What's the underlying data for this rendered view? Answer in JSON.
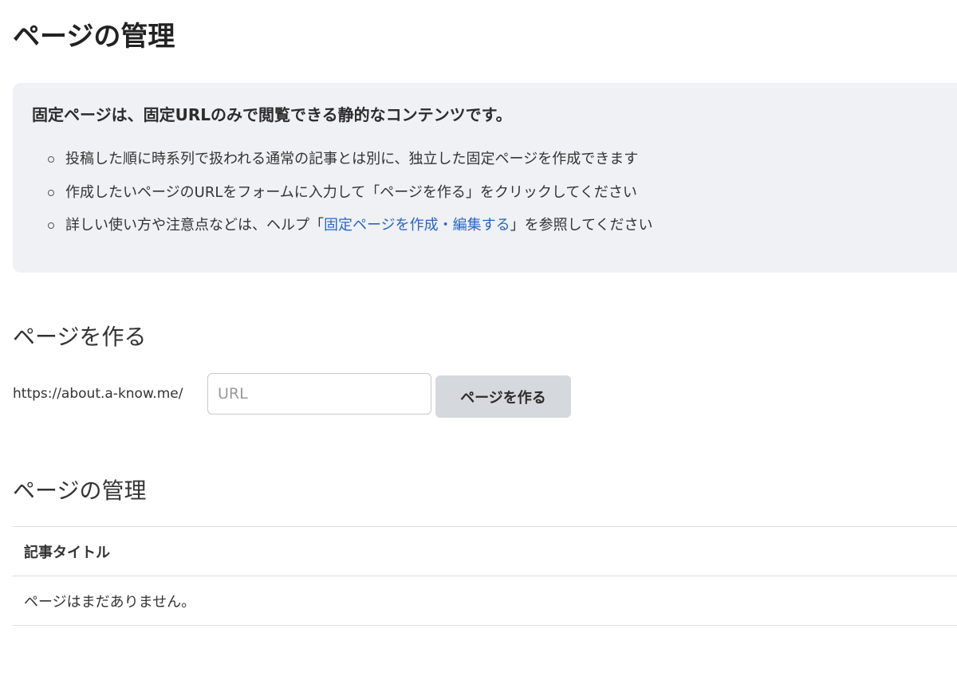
{
  "page": {
    "title": "ページの管理"
  },
  "info": {
    "lead": "固定ページは、固定URLのみで閲覧できる静的なコンテンツです。",
    "items": [
      "投稿した順に時系列で扱われる通常の記事とは別に、独立した固定ページを作成できます",
      "作成したいページのURLをフォームに入力して「ページを作る」をクリックしてください"
    ],
    "help_item": {
      "before": "詳しい使い方や注意点などは、ヘルプ「",
      "link": "固定ページを作成・編集する",
      "after": "」を参照してください"
    }
  },
  "create": {
    "heading": "ページを作る",
    "url_prefix": "https://about.a-know.me/",
    "input_value": "",
    "input_placeholder": "URL",
    "button_label": "ページを作る"
  },
  "manage": {
    "heading": "ページの管理",
    "table": {
      "columns": [
        "記事タイトル"
      ],
      "empty_message": "ページはまだありません。"
    }
  },
  "colors": {
    "info_background": "#f0f1f5",
    "link": "#2a64c6",
    "button_background": "#d5d8dd"
  }
}
